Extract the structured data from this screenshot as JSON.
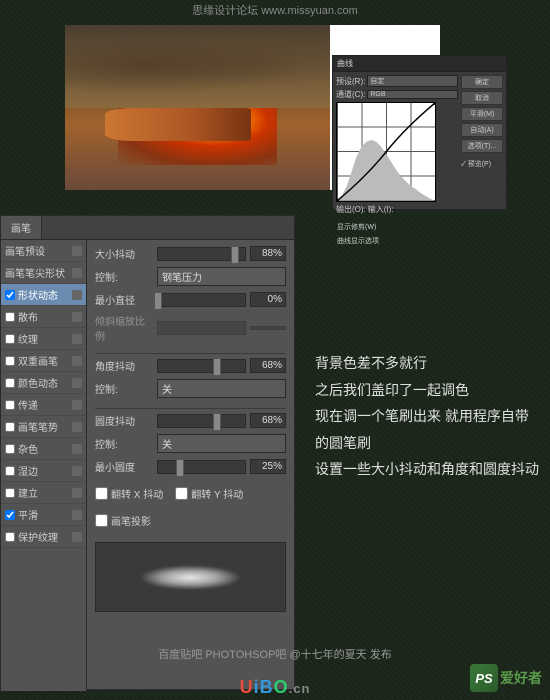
{
  "watermark": {
    "site": "思缘设计论坛",
    "url": "www.missyuan.com"
  },
  "curves": {
    "title": "曲线",
    "preset_label": "预设(R):",
    "preset_value": "自定",
    "channel_label": "通道(C):",
    "channel_value": "RGB",
    "buttons": {
      "ok": "确定",
      "cancel": "取消",
      "smooth": "平滑(M)",
      "auto": "自动(A)",
      "options": "选项(T)..."
    },
    "preview_check": "✓ 预览(P)",
    "output_label": "输出(O):",
    "input_label": "输入(I):",
    "show_clip": "显示修剪(W)",
    "curve_opts": "曲线显示选项"
  },
  "brush": {
    "tab": "画笔",
    "left_items": [
      {
        "label": "画笔预设",
        "checked": null
      },
      {
        "label": "画笔笔尖形状",
        "checked": null
      },
      {
        "label": "形状动态",
        "checked": true,
        "selected": true
      },
      {
        "label": "散布",
        "checked": false
      },
      {
        "label": "纹理",
        "checked": false
      },
      {
        "label": "双重画笔",
        "checked": false
      },
      {
        "label": "颜色动态",
        "checked": false
      },
      {
        "label": "传递",
        "checked": false
      },
      {
        "label": "画笔笔势",
        "checked": false
      },
      {
        "label": "杂色",
        "checked": false
      },
      {
        "label": "湿边",
        "checked": false
      },
      {
        "label": "建立",
        "checked": false
      },
      {
        "label": "平滑",
        "checked": true
      },
      {
        "label": "保护纹理",
        "checked": false
      }
    ],
    "right": {
      "size_jitter": {
        "label": "大小抖动",
        "value": "88%"
      },
      "control1": {
        "label": "控制:",
        "value": "钢笔压力"
      },
      "min_diameter": {
        "label": "最小直径",
        "value": "0%"
      },
      "tilt_scale": {
        "label": "倾斜缩放比例",
        "value": ""
      },
      "angle_jitter": {
        "label": "角度抖动",
        "value": "68%"
      },
      "control2": {
        "label": "控制:",
        "value": "关"
      },
      "round_jitter": {
        "label": "圆度抖动",
        "value": "68%"
      },
      "control3": {
        "label": "控制:",
        "value": "关"
      },
      "min_round": {
        "label": "最小圆度",
        "value": "25%"
      },
      "flip_x": "翻转 X 抖动",
      "flip_y": "翻转 Y 抖动",
      "brush_proj": "画笔投影"
    }
  },
  "instructions": {
    "line1": "背景色差不多就行",
    "line2": "之后我们盖印了一起调色",
    "line3": "现在调一个笔刷出来 就用程序自带的圆笔刷",
    "line4": "设置一些大小抖动和角度和圆度抖动"
  },
  "footer": "百度贴吧  PHOTOHSOP吧  @十七年的夏天 发布",
  "logo": {
    "badge": "PS",
    "text": "爱好者"
  },
  "uibo": "UiBO.cn"
}
